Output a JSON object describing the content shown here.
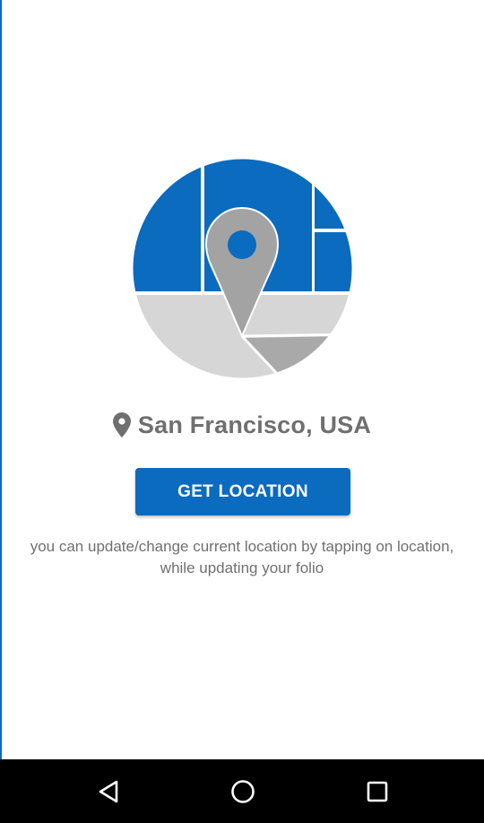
{
  "location": {
    "icon": "map-pin-icon",
    "text": "San Francisco, USA"
  },
  "actions": {
    "get_location_label": "GET LOCATION"
  },
  "helper": {
    "text": "you can update/change current location by tapping on location, while updating your folio"
  },
  "illustration": {
    "name": "map-illustration",
    "colors": {
      "water_blue": "#0a6bbf",
      "land_light": "#d6d6d6",
      "land_mid": "#a9a9a9",
      "pin_gray": "#a3a3a3"
    }
  },
  "navigation": {
    "back_icon": "back-triangle-icon",
    "home_icon": "home-circle-icon",
    "recents_icon": "recents-square-icon"
  },
  "theme": {
    "accent": "#0a6bbf",
    "text_gray": "#6f6f6f",
    "nav_bar": "#000000"
  }
}
